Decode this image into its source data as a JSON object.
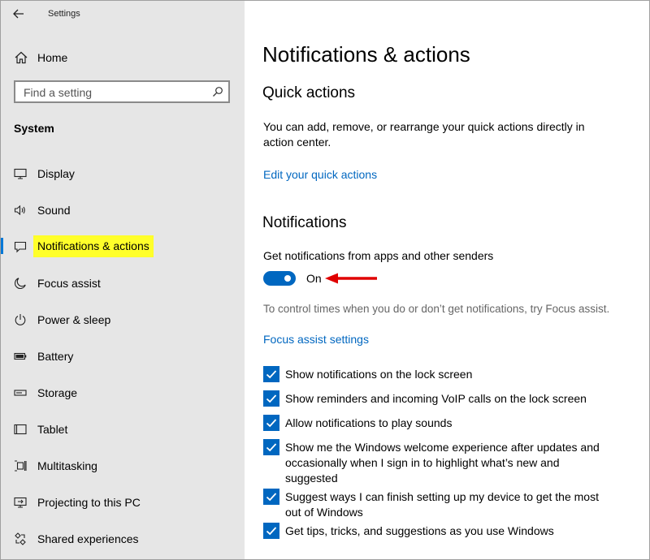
{
  "window": {
    "title": "Settings"
  },
  "sidebar": {
    "home_label": "Home",
    "search_placeholder": "Find a setting",
    "section_title": "System",
    "items": [
      {
        "label": "Display",
        "icon": "monitor-icon"
      },
      {
        "label": "Sound",
        "icon": "speaker-icon"
      },
      {
        "label": "Notifications & actions",
        "icon": "notification-icon",
        "active": true
      },
      {
        "label": "Focus assist",
        "icon": "moon-icon"
      },
      {
        "label": "Power & sleep",
        "icon": "power-icon"
      },
      {
        "label": "Battery",
        "icon": "battery-icon"
      },
      {
        "label": "Storage",
        "icon": "storage-icon"
      },
      {
        "label": "Tablet",
        "icon": "tablet-icon"
      },
      {
        "label": "Multitasking",
        "icon": "multitasking-icon"
      },
      {
        "label": "Projecting to this PC",
        "icon": "projector-icon"
      },
      {
        "label": "Shared experiences",
        "icon": "shared-icon"
      }
    ]
  },
  "main": {
    "page_title": "Notifications & actions",
    "quick_actions": {
      "heading": "Quick actions",
      "description": "You can add, remove, or rearrange your quick actions directly in action center.",
      "link": "Edit your quick actions"
    },
    "notifications": {
      "heading": "Notifications",
      "toggle_caption": "Get notifications from apps and other senders",
      "toggle_state": "On",
      "focus_text": "To control times when you do or don’t get notifications, try Focus assist.",
      "focus_link": "Focus assist settings",
      "checkboxes": [
        {
          "label": "Show notifications on the lock screen",
          "checked": true
        },
        {
          "label": "Show reminders and incoming VoIP calls on the lock screen",
          "checked": true
        },
        {
          "label": "Allow notifications to play sounds",
          "checked": true
        },
        {
          "label": "Show me the Windows welcome experience after updates and occasionally when I sign in to highlight what’s new and suggested",
          "checked": true
        },
        {
          "label": "Suggest ways I can finish setting up my device to get the most out of Windows",
          "checked": true
        },
        {
          "label": "Get tips, tricks, and suggestions as you use Windows",
          "checked": true
        }
      ]
    }
  },
  "colors": {
    "accent": "#0067c0",
    "highlight": "#ffff2a",
    "annotation_arrow": "#e00000"
  }
}
